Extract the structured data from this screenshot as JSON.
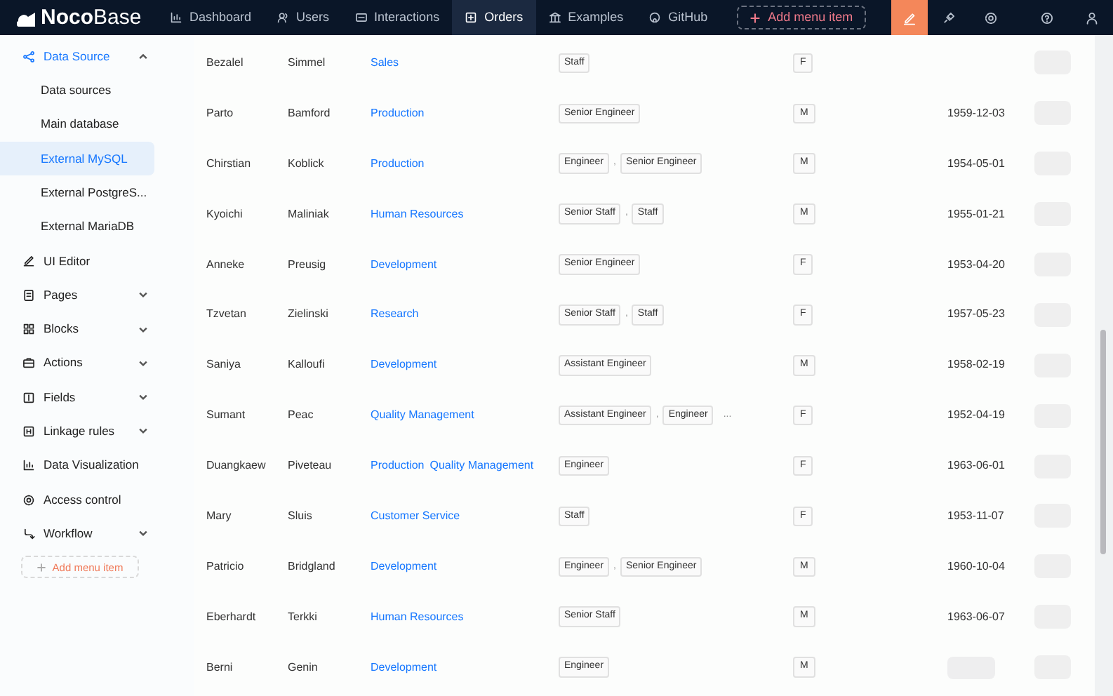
{
  "header": {
    "logo": {
      "bold": "Noco",
      "light": "Base"
    },
    "nav": [
      {
        "label": "Dashboard",
        "selected": false
      },
      {
        "label": "Users",
        "selected": false
      },
      {
        "label": "Interactions",
        "selected": false
      },
      {
        "label": "Orders",
        "selected": true
      },
      {
        "label": "Examples",
        "selected": false
      },
      {
        "label": "GitHub",
        "selected": false
      }
    ],
    "add_menu_item": "Add menu item",
    "ui_editor_on": true
  },
  "sidebar": {
    "items": [
      {
        "label": "Data Source",
        "kind": "group",
        "expanded": true,
        "children": [
          {
            "label": "Data sources",
            "selected": false
          },
          {
            "label": "Main database",
            "selected": false
          },
          {
            "label": "External MySQL",
            "selected": true
          },
          {
            "label": "External PostgreS...",
            "selected": false
          },
          {
            "label": "External MariaDB",
            "selected": false
          }
        ]
      },
      {
        "label": "UI Editor",
        "kind": "link"
      },
      {
        "label": "Pages",
        "kind": "group",
        "expanded": false
      },
      {
        "label": "Blocks",
        "kind": "group",
        "expanded": false
      },
      {
        "label": "Actions",
        "kind": "group",
        "expanded": false
      },
      {
        "label": "Fields",
        "kind": "group",
        "expanded": false
      },
      {
        "label": "Linkage rules",
        "kind": "group",
        "expanded": false
      },
      {
        "label": "Data Visualization",
        "kind": "link"
      },
      {
        "label": "Access control",
        "kind": "link"
      },
      {
        "label": "Workflow",
        "kind": "group",
        "expanded": false
      }
    ],
    "add_menu_item": "Add menu item"
  },
  "table": {
    "rows": [
      {
        "first_name": "Bezalel",
        "last_name": "Simmel",
        "departments": [
          "Sales"
        ],
        "titles": [
          "Staff"
        ],
        "gender": "F",
        "date_loading": false
      },
      {
        "first_name": "Parto",
        "last_name": "Bamford",
        "departments": [
          "Production"
        ],
        "titles": [
          "Senior Engineer"
        ],
        "gender": "M",
        "birth_date": "1959-12-03",
        "date_loading": false
      },
      {
        "first_name": "Chirstian",
        "last_name": "Koblick",
        "departments": [
          "Production"
        ],
        "titles": [
          "Engineer",
          "Senior Engineer"
        ],
        "separator": ",",
        "gender": "M",
        "birth_date": "1954-05-01",
        "date_loading": false
      },
      {
        "first_name": "Kyoichi",
        "last_name": "Maliniak",
        "departments": [
          "Human Resources"
        ],
        "titles": [
          "Senior Staff",
          "Staff"
        ],
        "separator": ",",
        "gender": "M",
        "birth_date": "1955-01-21",
        "date_loading": false
      },
      {
        "first_name": "Anneke",
        "last_name": "Preusig",
        "departments": [
          "Development"
        ],
        "titles": [
          "Senior Engineer"
        ],
        "gender": "F",
        "birth_date": "1953-04-20",
        "date_loading": false
      },
      {
        "first_name": "Tzvetan",
        "last_name": "Zielinski",
        "departments": [
          "Research"
        ],
        "titles": [
          "Senior Staff",
          "Staff"
        ],
        "separator": ",",
        "gender": "F",
        "birth_date": "1957-05-23",
        "date_loading": false
      },
      {
        "first_name": "Saniya",
        "last_name": "Kalloufi",
        "departments": [
          "Development"
        ],
        "titles": [
          "Assistant Engineer"
        ],
        "gender": "M",
        "birth_date": "1958-02-19",
        "date_loading": false
      },
      {
        "first_name": "Sumant",
        "last_name": "Peac",
        "departments": [
          "Quality Management"
        ],
        "titles": [
          "Assistant Engineer",
          "Engineer"
        ],
        "separator": ",",
        "more": "...",
        "gender": "F",
        "birth_date": "1952-04-19",
        "date_loading": false
      },
      {
        "first_name": "Duangkaew",
        "last_name": "Piveteau",
        "departments": [
          "Production",
          "Quality Management"
        ],
        "titles": [
          "Engineer"
        ],
        "gender": "F",
        "birth_date": "1963-06-01",
        "date_loading": false
      },
      {
        "first_name": "Mary",
        "last_name": "Sluis",
        "departments": [
          "Customer Service"
        ],
        "titles": [
          "Staff"
        ],
        "gender": "F",
        "birth_date": "1953-11-07",
        "date_loading": false
      },
      {
        "first_name": "Patricio",
        "last_name": "Bridgland",
        "departments": [
          "Development"
        ],
        "titles": [
          "Engineer",
          "Senior Engineer"
        ],
        "separator": ",",
        "gender": "M",
        "birth_date": "1960-10-04",
        "date_loading": false
      },
      {
        "first_name": "Eberhardt",
        "last_name": "Terkki",
        "departments": [
          "Human Resources"
        ],
        "titles": [
          "Senior Staff"
        ],
        "gender": "M",
        "birth_date": "1963-06-07",
        "date_loading": false
      },
      {
        "first_name": "Berni",
        "last_name": "Genin",
        "departments": [
          "Development"
        ],
        "titles": [
          "Engineer"
        ],
        "gender": "M",
        "date_loading": true
      }
    ]
  }
}
